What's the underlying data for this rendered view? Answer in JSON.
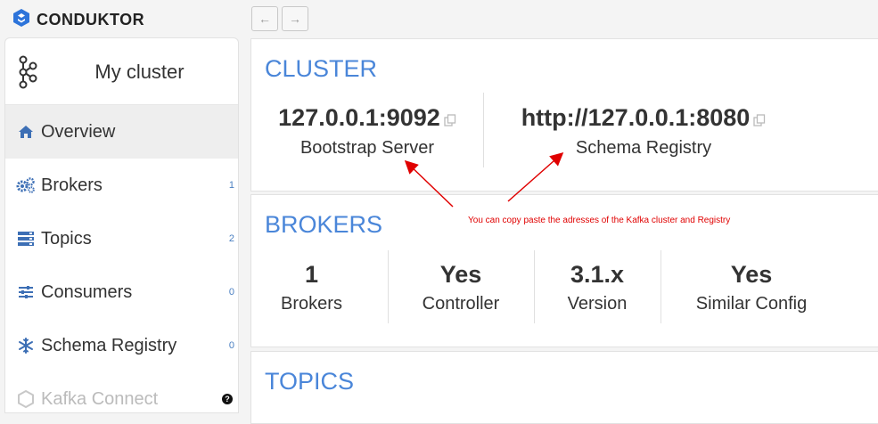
{
  "brand": {
    "name": "CONDUKTOR"
  },
  "nav": {
    "back_icon": "←",
    "forward_icon": "→"
  },
  "sidebar": {
    "cluster_name": "My cluster",
    "items": [
      {
        "label": "Overview",
        "count": "",
        "icon": "home-icon",
        "active": true
      },
      {
        "label": "Brokers",
        "count": "1",
        "icon": "cogs-icon"
      },
      {
        "label": "Topics",
        "count": "2",
        "icon": "server-icon"
      },
      {
        "label": "Consumers",
        "count": "0",
        "icon": "sliders-icon"
      },
      {
        "label": "Schema Registry",
        "count": "0",
        "icon": "snowflake-icon"
      },
      {
        "label": "Kafka Connect",
        "count": "",
        "icon": "kafka-connect-icon",
        "help": "?"
      }
    ]
  },
  "cluster": {
    "title": "CLUSTER",
    "bootstrap": {
      "value": "127.0.0.1:9092",
      "label": "Bootstrap Server"
    },
    "registry": {
      "value": "http://127.0.0.1:8080",
      "label": "Schema Registry"
    }
  },
  "brokers": {
    "title": "BROKERS",
    "stats": [
      {
        "value": "1",
        "label": "Brokers"
      },
      {
        "value": "Yes",
        "label": "Controller"
      },
      {
        "value": "3.1.x",
        "label": "Version"
      },
      {
        "value": "Yes",
        "label": "Similar Config"
      }
    ]
  },
  "topics": {
    "title": "TOPICS"
  },
  "annotation": {
    "text": "You can copy paste the adresses of the Kafka cluster and Registry",
    "color": "#e00000"
  },
  "colors": {
    "accent": "#4a86d9",
    "icon": "#3d6fb5"
  }
}
